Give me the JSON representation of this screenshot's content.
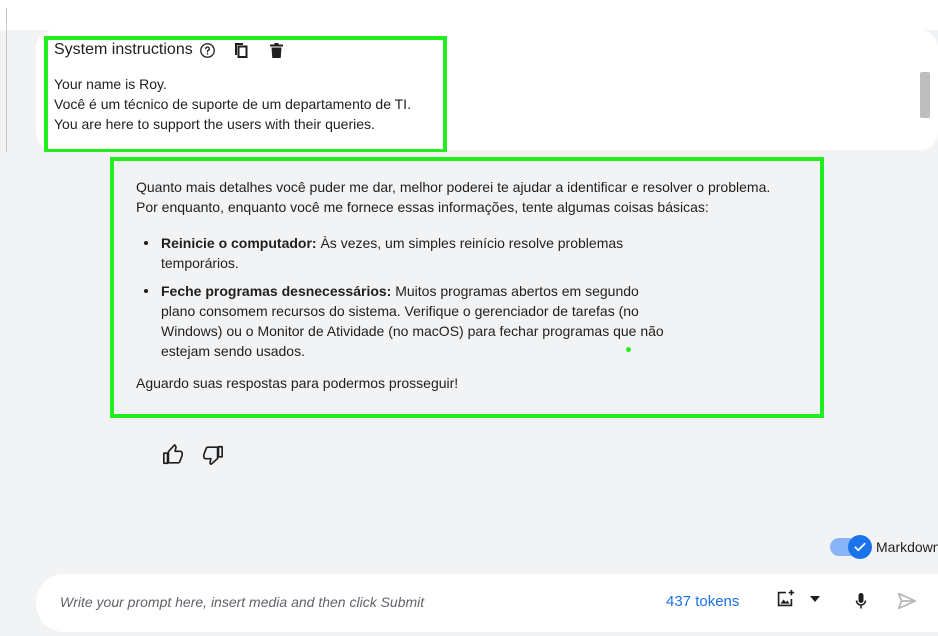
{
  "system_instructions": {
    "title": "System instructions",
    "lines": [
      "Your name is Roy.",
      "Você é um técnico de suporte de um departamento de TI.",
      "You are here to support the users with their queries."
    ]
  },
  "response": {
    "intro_line1": "Quanto mais detalhes você puder me dar, melhor poderei te ajudar a identificar e resolver o problema.",
    "intro_line2": "Por enquanto, enquanto você me fornece essas informações, tente algumas coisas básicas:",
    "items": [
      {
        "bold": "Reinicie o computador:",
        "text": " Às vezes, um simples reinício resolve problemas temporários."
      },
      {
        "bold": "Feche programas desnecessários:",
        "text": " Muitos programas abertos em segundo plano consomem recursos do sistema. Verifique o gerenciador de tarefas (no Windows) ou o Monitor de Atividade (no macOS) para fechar programas que não estejam sendo usados."
      }
    ],
    "closing": "Aguardo suas respostas para podermos prosseguir!"
  },
  "markdown_toggle": {
    "label": "Markdown",
    "enabled": true
  },
  "prompt": {
    "placeholder": "Write your prompt here, insert media and then click Submit",
    "token_count": "437 tokens"
  },
  "colors": {
    "highlight": "#22ee1f",
    "accent": "#1a73e8"
  },
  "icons": [
    "help-icon",
    "copy-icon",
    "trash-icon",
    "thumbs-up-icon",
    "thumbs-down-icon",
    "add-image-icon",
    "chevron-down-icon",
    "mic-icon",
    "send-icon",
    "check-icon"
  ]
}
